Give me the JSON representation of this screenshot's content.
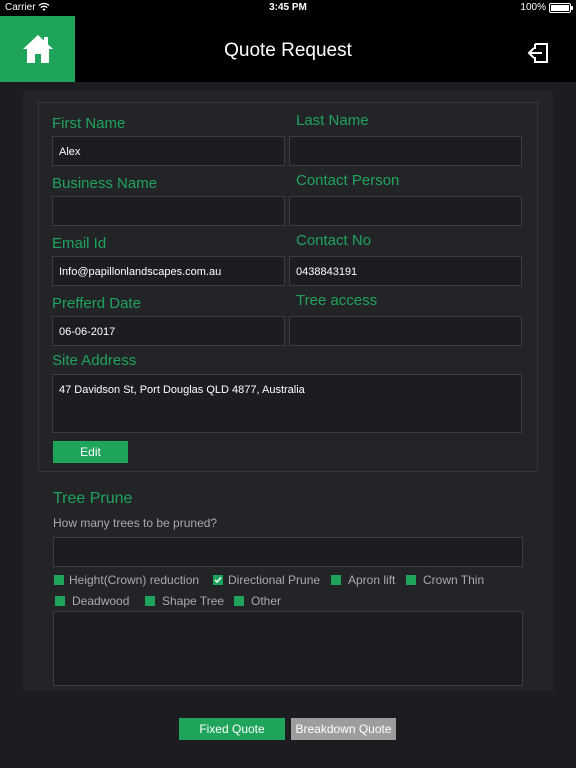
{
  "status": {
    "carrier": "Carrier",
    "time": "3:45 PM",
    "battery": "100%"
  },
  "nav": {
    "title": "Quote Request",
    "home_icon": "home-icon",
    "logout_icon": "logout-icon"
  },
  "form": {
    "first_name": {
      "label": "First Name",
      "value": "Alex"
    },
    "last_name": {
      "label": "Last Name",
      "value": ""
    },
    "business_name": {
      "label": "Business Name",
      "value": ""
    },
    "contact_person": {
      "label": "Contact Person",
      "value": ""
    },
    "email": {
      "label": "Email Id",
      "value": "Info@papillonlandscapes.com.au"
    },
    "contact_no": {
      "label": "Contact No",
      "value": "0438843191"
    },
    "preferred_date": {
      "label": "Prefferd Date",
      "value": "06-06-2017"
    },
    "tree_access": {
      "label": "Tree access",
      "value": ""
    },
    "site_address": {
      "label": "Site Address",
      "value": "47 Davidson St, Port Douglas QLD 4877, Australia"
    },
    "edit_label": "Edit"
  },
  "tree_prune": {
    "title": "Tree Prune",
    "question": "How many trees to be pruned?",
    "count_value": "",
    "options": [
      {
        "label": "Height(Crown) reduction",
        "checked": false
      },
      {
        "label": "Directional Prune",
        "checked": true
      },
      {
        "label": "Apron lift",
        "checked": false
      },
      {
        "label": "Crown Thin",
        "checked": false
      },
      {
        "label": "Deadwood",
        "checked": false
      },
      {
        "label": "Shape Tree",
        "checked": false
      },
      {
        "label": "Other",
        "checked": false
      }
    ],
    "notes_value": ""
  },
  "footer": {
    "fixed_quote": "Fixed Quote",
    "breakdown_quote": "Breakdown Quote"
  },
  "colors": {
    "accent": "#1fa45b",
    "background": "#1c1d21",
    "panel": "#232428",
    "secondary_button": "#9d9d9d"
  }
}
